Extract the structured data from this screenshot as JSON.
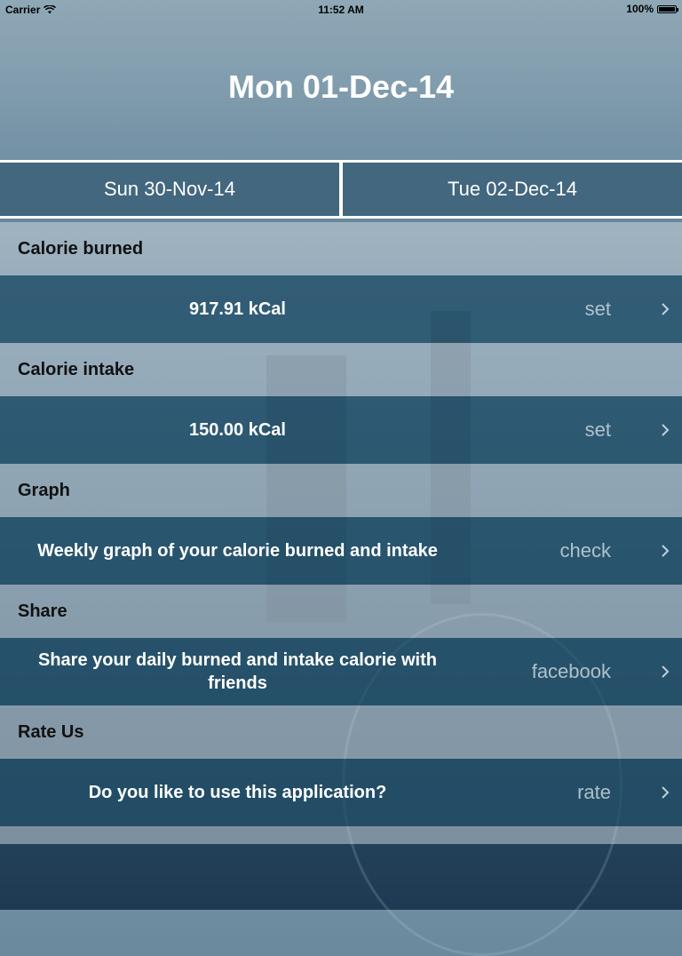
{
  "status_bar": {
    "carrier": "Carrier",
    "time": "11:52 AM",
    "battery": "100%",
    "battery_level": 1.0
  },
  "header": {
    "title": "Mon 01-Dec-14"
  },
  "navigation": {
    "previous_day": "Sun 30-Nov-14",
    "next_day": "Tue 02-Dec-14"
  },
  "sections": [
    {
      "header": "Calorie burned",
      "cell_text": "917.91 kCal",
      "action": "set"
    },
    {
      "header": "Calorie intake",
      "cell_text": "150.00 kCal",
      "action": "set"
    },
    {
      "header": "Graph",
      "cell_text": "Weekly graph of your calorie burned and intake",
      "action": "check"
    },
    {
      "header": "Share",
      "cell_text": "Share your daily burned and intake calorie with friends",
      "action": "facebook"
    },
    {
      "header": "Rate Us",
      "cell_text": "Do you like to use this application?",
      "action": "rate"
    }
  ],
  "icons": {
    "wifi": "wifi-icon",
    "battery": "battery-icon",
    "chevron": "chevron-right-icon"
  }
}
